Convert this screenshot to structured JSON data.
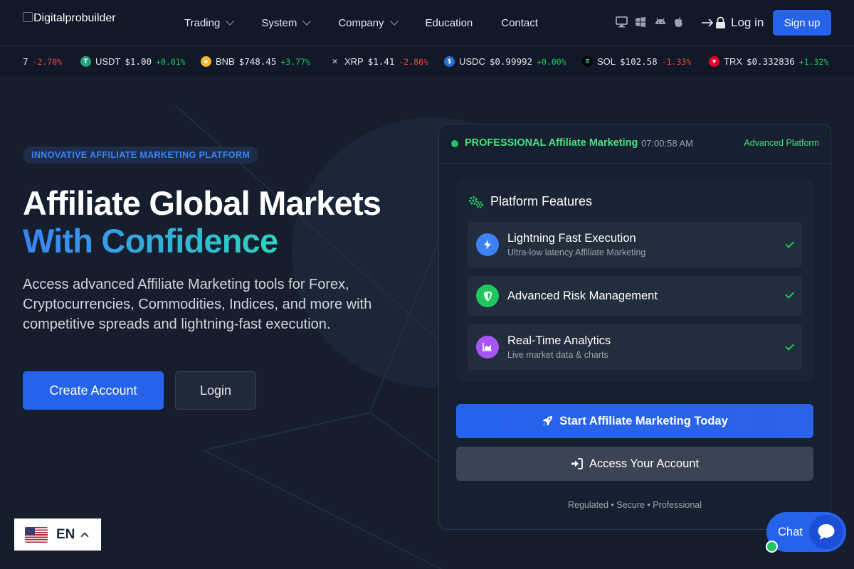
{
  "nav": {
    "logo_text": "Digitalprobuilder",
    "menu": [
      {
        "label": "Trading",
        "has_dropdown": true
      },
      {
        "label": "System",
        "has_dropdown": true
      },
      {
        "label": "Company",
        "has_dropdown": true
      },
      {
        "label": "Education",
        "has_dropdown": false
      },
      {
        "label": "Contact",
        "has_dropdown": false
      }
    ],
    "platform_icons": [
      "desktop-icon",
      "windows-icon",
      "android-icon",
      "apple-icon"
    ],
    "login_label": "Log in",
    "signup_label": "Sign up"
  },
  "ticker": [
    {
      "symbol": "",
      "price": "7",
      "change": "-2.70%",
      "direction": "neg",
      "icon": "",
      "color": ""
    },
    {
      "symbol": "USDT",
      "price": "$1.00",
      "change": "+0.01%",
      "direction": "pos",
      "icon": "tether-icon",
      "color": "#26a17b"
    },
    {
      "symbol": "BNB",
      "price": "$748.45",
      "change": "+3.77%",
      "direction": "pos",
      "icon": "bnb-icon",
      "color": "#f3ba2f"
    },
    {
      "symbol": "XRP",
      "price": "$1.41",
      "change": "-2.86%",
      "direction": "neg",
      "icon": "xrp-icon",
      "color": "#23292f"
    },
    {
      "symbol": "USDC",
      "price": "$0.99992",
      "change": "+0.00%",
      "direction": "pos",
      "icon": "usdc-icon",
      "color": "#2775ca"
    },
    {
      "symbol": "SOL",
      "price": "$102.58",
      "change": "-1.33%",
      "direction": "neg",
      "icon": "solana-icon",
      "color": "#000000"
    },
    {
      "symbol": "TRX",
      "price": "$0.332836",
      "change": "+1.32%",
      "direction": "pos",
      "icon": "tron-icon",
      "color": "#eb0029"
    }
  ],
  "hero": {
    "badge": "INNOVATIVE AFFILIATE MARKETING PLATFORM",
    "title_line1": "Affiliate Global Markets",
    "title_line2": "With Confidence",
    "description": "Access advanced Affiliate Marketing tools for Forex, Cryptocurrencies, Commodities, Indices, and more with competitive spreads and lightning-fast execution.",
    "create_label": "Create Account",
    "login_label": "Login"
  },
  "panel": {
    "live_label": "PROFESSIONAL Affiliate Marketing",
    "clock": "07:00:58 AM",
    "tag": "Advanced Platform",
    "features_title": "Platform Features",
    "features": [
      {
        "title": "Lightning Fast Execution",
        "subtitle": "Ultra-low latency Affiliate Marketing",
        "icon": "bolt-icon",
        "color": "#3b82f6"
      },
      {
        "title": "Advanced Risk Management",
        "subtitle": "",
        "icon": "shield-icon",
        "color": "#22c55e"
      },
      {
        "title": "Real-Time Analytics",
        "subtitle": "Live market data & charts",
        "icon": "chart-area-icon",
        "color": "#a855f7"
      }
    ],
    "start_label": "Start Affiliate Marketing Today",
    "access_label": "Access Your Account",
    "footer": "Regulated • Secure • Professional"
  },
  "language": {
    "code": "EN",
    "flag": "us-flag-icon"
  },
  "chat": {
    "label": "Chat"
  },
  "colors": {
    "accent": "#2563eb",
    "positive": "#22c55e",
    "negative": "#ef4444",
    "bg": "#111827"
  }
}
